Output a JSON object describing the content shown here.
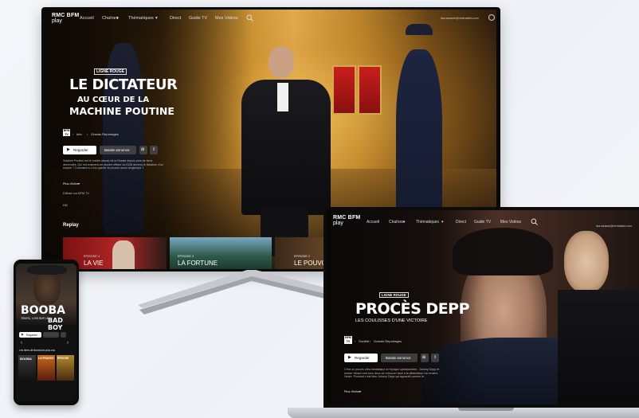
{
  "tv": {
    "nav": {
      "logo_line1": "RMC BFM",
      "logo_line2": "play",
      "items": [
        "Accueil",
        "Chaînes",
        "Thématiques",
        "Direct",
        "Guide TV",
        "Mes Vidéos"
      ],
      "account": "lisa.sarasse@nextradiotv.com"
    },
    "program": {
      "label": "LIGNE ROUGE",
      "title_line1": "LE DICTATEUR",
      "title_line2": "AU CŒUR DE LA",
      "title_line3": "MACHINE POUTINE",
      "channel": "BFM TV",
      "breadcrumb": [
        "Info",
        "Grands Reportages"
      ],
      "play_label": "Regarder",
      "trailer_label": "Bande annonce",
      "description": "Vladimir Poutine est le maître absolu de la Russie depuis plus de deux décennies. Qui est vraiment cet ancien officier du KGB devenu le dictateur d'un empire ? Comment a-t-il su garder le pouvoir aussi longtemps ?",
      "more_label": "Plus d'infos",
      "broadcast": "Diffusé sur BFM TV",
      "quality": "HD"
    },
    "replay": {
      "heading": "Replay",
      "episodes": [
        {
          "episode": "EPISODE 4",
          "title": "LA VIE"
        },
        {
          "episode": "EPISODE 3",
          "title": "LA FORTUNE"
        },
        {
          "episode": "EPISODE 2",
          "title": "LE POUVOIR"
        }
      ]
    }
  },
  "laptop": {
    "nav": {
      "logo_line1": "RMC BFM",
      "logo_line2": "play",
      "items": [
        "Accueil",
        "Chaînes",
        "Thématiques",
        "Direct",
        "Guide TV",
        "Mes Vidéos"
      ],
      "account": "lisa.sarasse@nextradiotv.com"
    },
    "program": {
      "label": "LIGNE ROUGE",
      "title": "PROCÈS DEPP",
      "subtitle": "LES COULISSES D'UNE VICTOIRE",
      "channel": "BFM TV",
      "breadcrumb": [
        "Société",
        "Grands Reportages"
      ],
      "play_label": "Regarder",
      "trailer_label": "Bande annonce",
      "description": "C'est un procès ultra médiatique à l'époque spectaculaire : Johnny Depp et Amber Heard vont tous deux se retrouver face à la diffamation l'un envers l'autre. Pourtant c'est bien Johnny Depp qui apparaît comme le…",
      "more_label": "Plus d'infos"
    }
  },
  "phone": {
    "program": {
      "title": "BOOBA",
      "subtitle": "TRAFIC, LOIS SUR LE",
      "title2": "BAD BOY",
      "play_label": "Regarder",
      "section": "Les titres de Booba les plus vus",
      "posters": [
        "BOOBA",
        "LA FRANCE",
        "ÉPISODE"
      ]
    }
  },
  "colors": {
    "accent": "#ffffff",
    "badge_border": "#d0d0d0",
    "replay_thumb_4": "#8a1a1a",
    "replay_thumb_3": "#3a6d8a",
    "replay_thumb_2": "#3a2818"
  }
}
